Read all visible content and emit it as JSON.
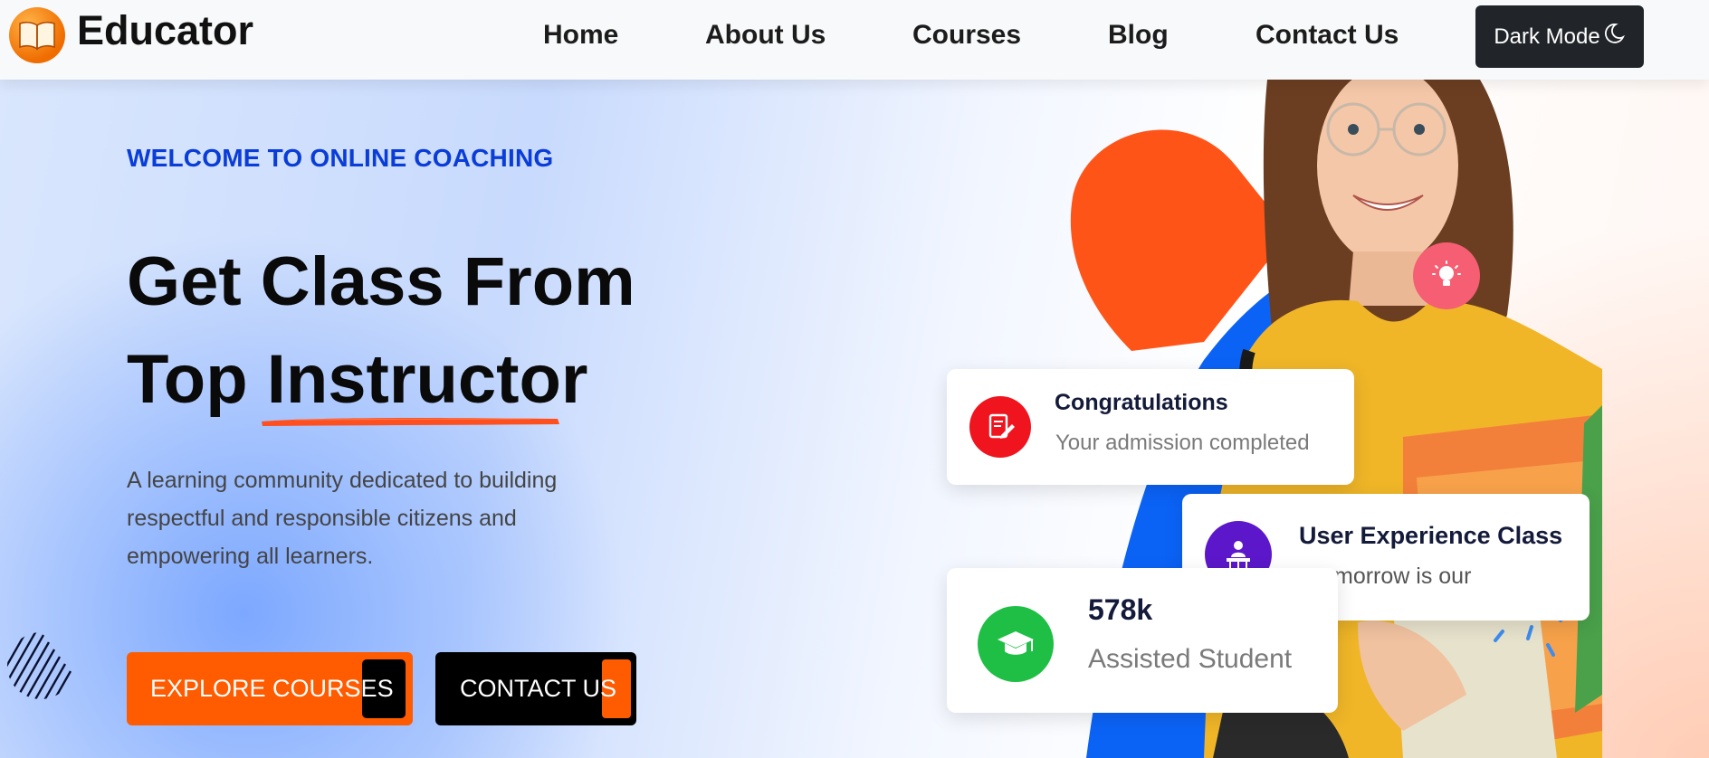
{
  "nav": {
    "logo_text": "Educator",
    "links": [
      "Home",
      "About Us",
      "Courses",
      "Blog",
      "Contact Us"
    ],
    "dark_mode_label": "Dark Mode"
  },
  "hero": {
    "eyebrow": "WELCOME TO ONLINE COACHING",
    "headline_line1": "Get Class From",
    "headline_line2": "Top Instructor",
    "description": "A learning community dedicated to building respectful and responsible citizens and empowering all learners.",
    "explore_button": "EXPLORE COURSES",
    "contact_button": "CONTACT US"
  },
  "cards": {
    "congrats": {
      "title": "Congratulations",
      "subtitle": "Your admission completed"
    },
    "ux_class": {
      "title": "User Experience Class",
      "subtitle": "morrow is our"
    },
    "students": {
      "count": "578k",
      "label": "Assisted Student"
    }
  },
  "colors": {
    "accent_orange": "#ff5b00",
    "eyebrow_blue": "#0a3cd8",
    "nav_dark": "#212529",
    "card_red": "#f0141e",
    "card_purple": "#5b17c9",
    "card_green": "#1fbf46"
  },
  "icons": [
    "open-book-icon",
    "moon-icon",
    "lightbulb-icon",
    "document-edit-icon",
    "user-presenter-icon",
    "graduation-cap-icon"
  ]
}
